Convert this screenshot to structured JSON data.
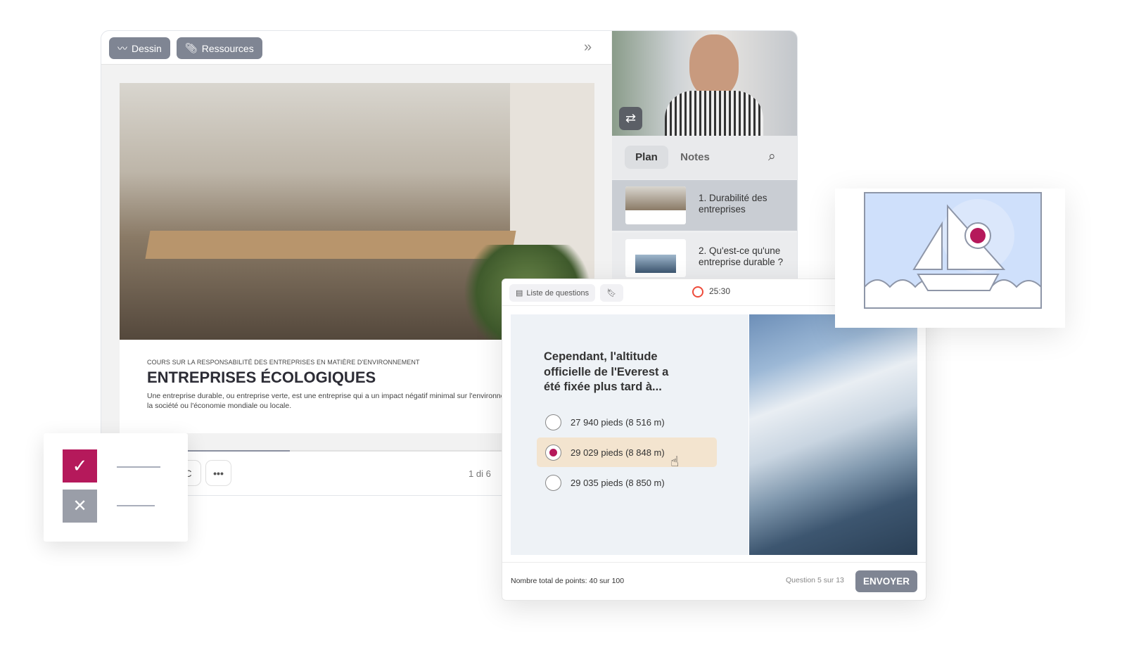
{
  "toolbar": {
    "draw_label": "Dessin",
    "resources_label": "Ressources"
  },
  "slide": {
    "kicker": "COURS SUR LA RESPONSABILITÉ DES ENTREPRISES EN MATIÈRE D'ENVIRONNEMENT",
    "title": "ENTREPRISES ÉCOLOGIQUES",
    "description": "Une entreprise durable, ou entreprise verte, est une entreprise qui a un impact négatif minimal sur l'environnement, la communauté, la société ou l'économie mondiale ou locale."
  },
  "player": {
    "partial_button": "C",
    "page": "1 di 6",
    "progress_percent": 37
  },
  "sidebar": {
    "tabs": [
      {
        "label": "Plan",
        "active": true
      },
      {
        "label": "Notes",
        "active": false
      }
    ],
    "items": [
      {
        "label": "1. Durabilité des entreprises",
        "active": true
      },
      {
        "label": "2. Qu'est-ce qu'une entreprise durable ?",
        "active": false
      }
    ]
  },
  "quiz": {
    "list_label": "Liste de questions",
    "timer": "25:30",
    "question": "Cependant, l'altitude officielle de l'Everest a été fixée plus tard à...",
    "options": [
      {
        "label": "27 940 pieds (8 516 m)",
        "selected": false
      },
      {
        "label": "29 029 pieds (8 848 m)",
        "selected": true
      },
      {
        "label": "29 035 pieds (8 850 m)",
        "selected": false
      }
    ],
    "points": "Nombre total de points: 40 sur 100",
    "position": "Question 5 sur 13",
    "submit_label": "ENVOYER"
  },
  "colors": {
    "accent": "#b5195b",
    "button": "#7f8593",
    "selected_option": "#f3e4cf",
    "placeholder_sky": "#cfe0fb"
  }
}
